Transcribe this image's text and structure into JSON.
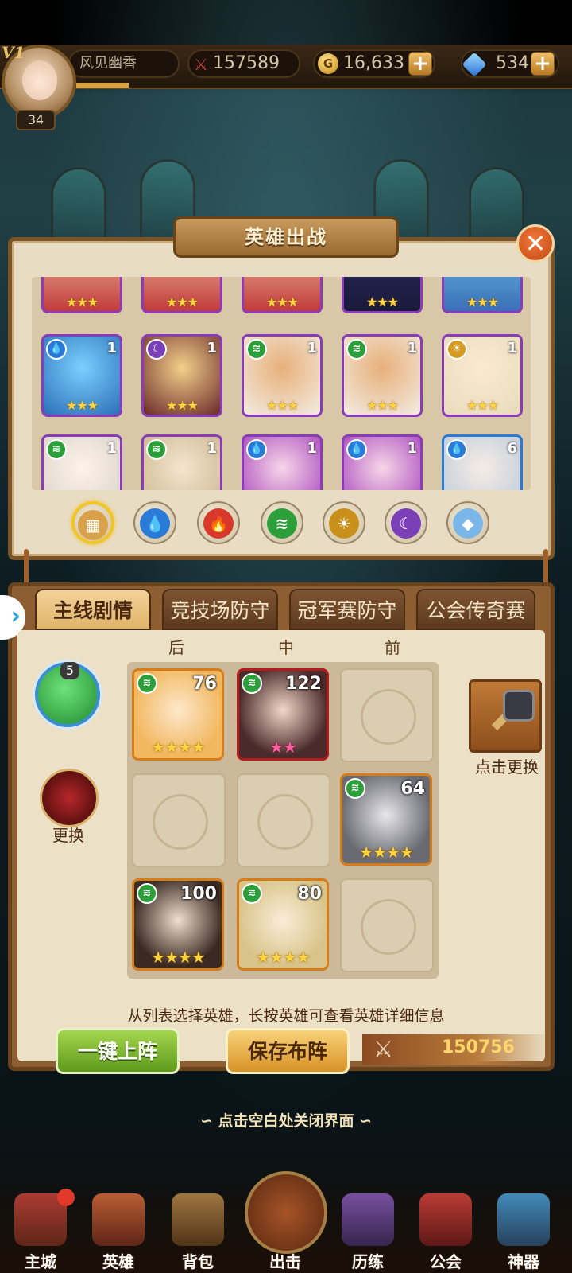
{
  "topbar": {
    "vip": "V1",
    "level": "34",
    "player_name": "风见幽香",
    "power": "157589",
    "gold": "16,633",
    "gems": "534",
    "plus": "+"
  },
  "dialog": {
    "title": "英雄出战",
    "close": "✕"
  },
  "hero_list": [
    {
      "count": "",
      "stars": "★★★",
      "element": ""
    },
    {
      "count": "",
      "stars": "★★★",
      "element": ""
    },
    {
      "count": "",
      "stars": "★★★",
      "element": ""
    },
    {
      "count": "",
      "stars": "★★★",
      "element": ""
    },
    {
      "count": "",
      "stars": "★★★",
      "element": ""
    },
    {
      "count": "1",
      "stars": "★★★",
      "element": "water"
    },
    {
      "count": "1",
      "stars": "★★★",
      "element": "moon"
    },
    {
      "count": "1",
      "stars": "★★★",
      "element": "wind"
    },
    {
      "count": "1",
      "stars": "★★★",
      "element": "wind"
    },
    {
      "count": "1",
      "stars": "★★★",
      "element": "sun"
    },
    {
      "count": "1",
      "stars": "",
      "element": "wind"
    },
    {
      "count": "1",
      "stars": "",
      "element": "wind"
    },
    {
      "count": "1",
      "stars": "",
      "element": "water"
    },
    {
      "count": "1",
      "stars": "",
      "element": "water"
    },
    {
      "count": "6",
      "stars": "",
      "element": "water"
    }
  ],
  "filters": [
    "all",
    "water",
    "fire",
    "wind",
    "sun",
    "moon",
    "special"
  ],
  "tabs": [
    "主线剧情",
    "竞技场防守",
    "冠军赛防守",
    "公会传奇赛"
  ],
  "rows": {
    "back": "后",
    "middle": "中",
    "front": "前"
  },
  "formation": [
    {
      "level": "76",
      "stars": "★★★★",
      "element": "wind"
    },
    {
      "level": "122",
      "stars": "★★",
      "element": "wind"
    },
    {
      "level": "64",
      "stars": "★★★★",
      "element": "wind"
    },
    {
      "level": "100",
      "stars": "★★★★",
      "element": "wind"
    },
    {
      "level": "80",
      "stars": "★★★★",
      "element": "wind"
    }
  ],
  "side": {
    "orb_count": "5",
    "change_label": "更换",
    "artifact_label": "点击更换"
  },
  "hint": "从列表选择英雄，长按英雄可查看英雄详细信息",
  "buttons": {
    "auto_deploy": "一键上阵",
    "save": "保存布阵"
  },
  "formation_power": "150756",
  "close_hint": "∽ 点击空白处关闭界面 ∽",
  "nav": [
    "主城",
    "英雄",
    "背包",
    "出击",
    "历练",
    "公会",
    "神器"
  ],
  "colors": {
    "panel": "#e8dcc4",
    "frame": "#7c5428",
    "accent_gold": "#f0c42a",
    "hero_frame_purple": "#8a3bb8"
  }
}
